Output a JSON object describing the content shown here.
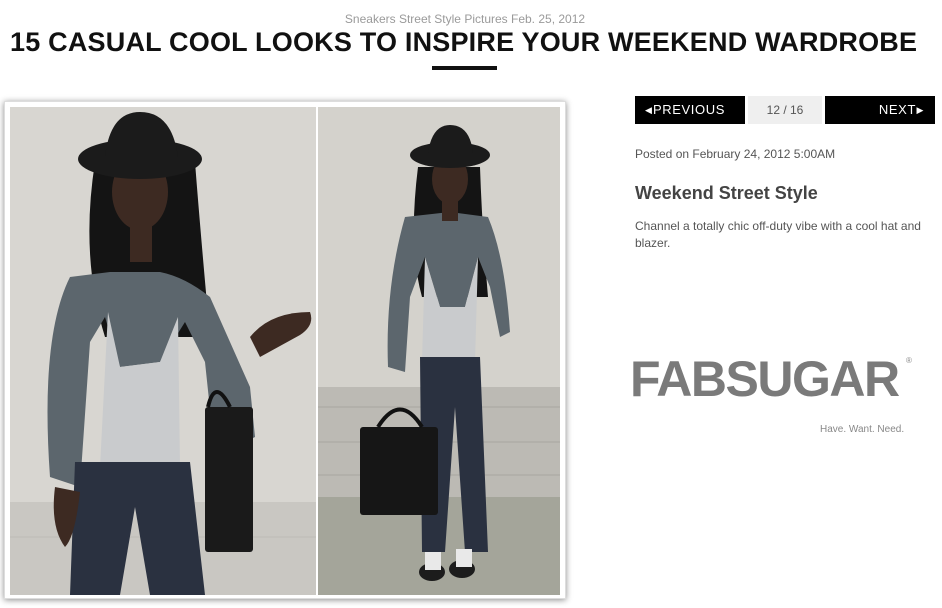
{
  "header": {
    "kicker": "Sneakers Street Style Pictures Feb. 25, 2012",
    "title": "15 CASUAL COOL LOOKS TO INSPIRE YOUR WEEKEND WARDROBE"
  },
  "pager": {
    "prev_label": "PREVIOUS",
    "next_label": "NEXT",
    "count": "12 / 16",
    "prev_arrow": "◀",
    "next_arrow": "▶"
  },
  "slide": {
    "posted": "Posted on February 24, 2012 5:00AM",
    "title": "Weekend Street Style",
    "description": "Channel a totally chic off-duty vibe with a cool hat and blazer."
  },
  "brand": {
    "logo": "FABSUGAR",
    "registered": "®",
    "tagline": "Have. Want. Need."
  },
  "photo": {
    "colors": {
      "wall": "#d6d4cf",
      "blazer": "#5c666d",
      "tee": "#c9cbcd",
      "jeans": "#2a3140",
      "hat": "#1b1b1b",
      "skin": "#3d2a22"
    }
  }
}
